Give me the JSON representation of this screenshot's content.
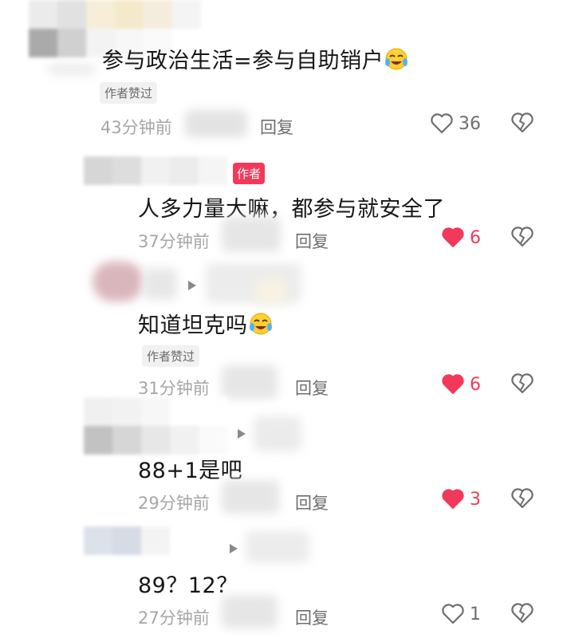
{
  "comments": [
    {
      "text": "参与政治生活=参与自助销户",
      "emoji": "crying-laughing-emoji",
      "author_liked": "作者赞过",
      "time": "43分钟前",
      "reply": "回复",
      "likes": "36",
      "liked": false
    },
    {
      "author_tag": "作者",
      "text": "人多力量大嘛，都参与就安全了",
      "time": "37分钟前",
      "reply": "回复",
      "likes": "6",
      "liked": true
    },
    {
      "text": "知道坦克吗",
      "emoji": "crying-laughing-emoji",
      "author_liked": "作者赞过",
      "time": "31分钟前",
      "reply": "回复",
      "likes": "6",
      "liked": true
    },
    {
      "text": "88+1是吧",
      "time": "29分钟前",
      "reply": "回复",
      "likes": "3",
      "liked": true
    },
    {
      "text": "89？12？",
      "time": "27分钟前",
      "reply": "回复",
      "likes": "1",
      "liked": false
    }
  ],
  "colors": {
    "like_active": "#f2395b",
    "text": "#161616",
    "meta": "#a6a6a6"
  },
  "icons": {
    "like": "heart-icon",
    "dislike": "broken-heart-icon",
    "reply_arrow": "reply-arrow-icon"
  }
}
